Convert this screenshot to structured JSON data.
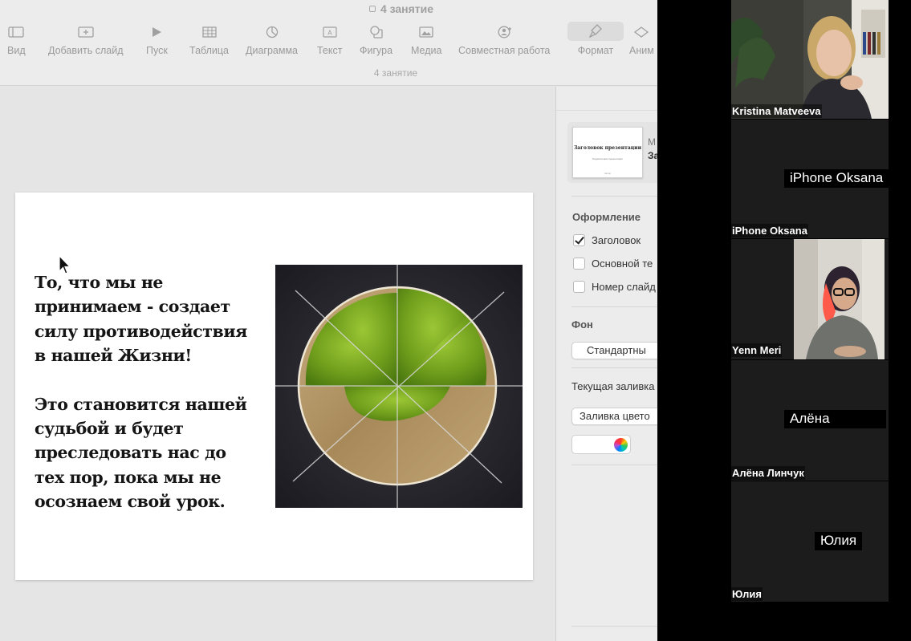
{
  "window": {
    "title": "4 занятие",
    "subtitle": "4 занятие"
  },
  "toolbar": {
    "view": "Вид",
    "add_slide": "Добавить слайд",
    "play": "Пуск",
    "table": "Таблица",
    "chart": "Диаграмма",
    "text": "Текст",
    "shape": "Фигура",
    "media": "Медиа",
    "collaborate": "Совместная работа",
    "format": "Формат",
    "animate": "Аним"
  },
  "slide": {
    "paragraph1": "То, что мы не принимаем - создает силу противодействия в нашей Жизни!",
    "paragraph2": "Это становится нашей судьбой и будет преследовать нас до тех пор, пока мы не осознаем свой урок.",
    "image_icon": "green-and-sand-circle-image"
  },
  "inspector": {
    "layout_thumb_title": "Заголовок презентации",
    "layout_thumb_subtitle": "Подзаголовок презентации",
    "layout_thumb_author": "Автор",
    "layout_prefix": "М",
    "layout_name": "За",
    "appearance_header": "Оформление",
    "title_checkbox": "Заголовок",
    "title_checked": true,
    "body_checkbox": "Основной те",
    "body_checked": false,
    "slide_number_checkbox": "Номер слайд",
    "slide_number_checked": false,
    "background_header": "Фон",
    "background_value": "Стандартны",
    "current_fill_label": "Текущая заливка",
    "fill_type_value": "Заливка цвето",
    "fill_color": "#ffffff"
  },
  "zoom": {
    "participants": [
      {
        "label": "Kristina Matveeva",
        "video": true
      },
      {
        "label": "iPhone Oksana",
        "center_label": "iPhone Oksana",
        "video": false
      },
      {
        "label": "Yenn Meri",
        "video": true
      },
      {
        "label": "Алёна Линчук",
        "center_label": "Алёна",
        "video": false
      },
      {
        "label": "Юлия",
        "center_label": "Юлия",
        "video": false
      }
    ]
  }
}
